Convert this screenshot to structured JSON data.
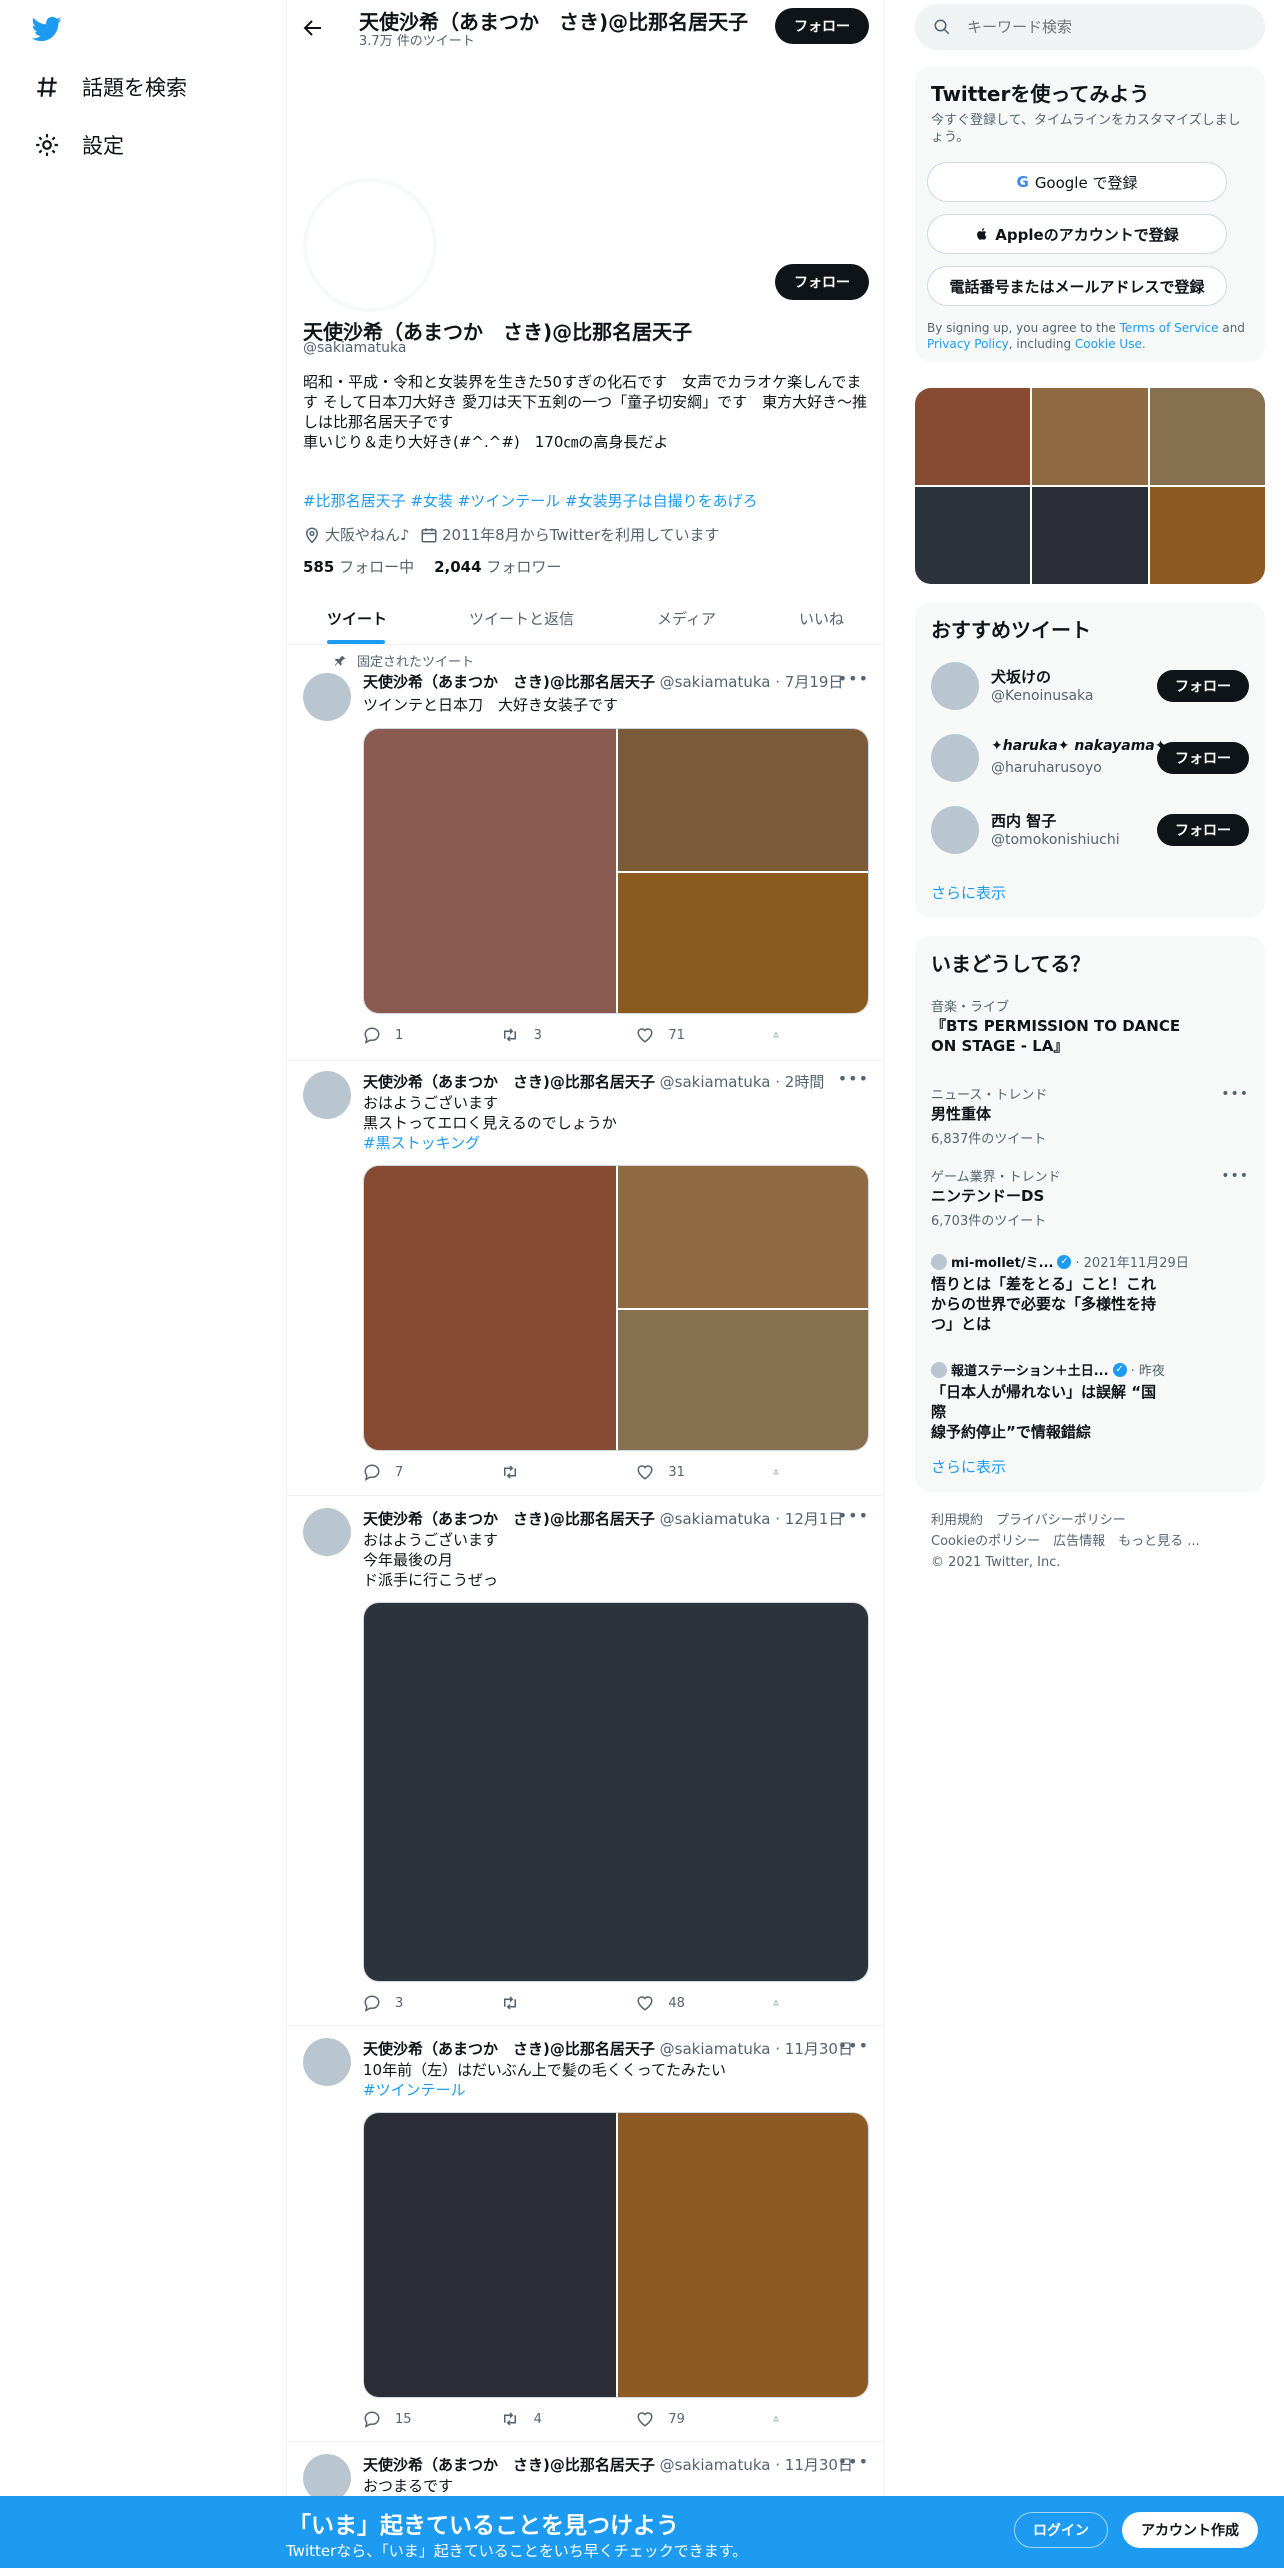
{
  "nav": {
    "explore_label": "話題を検索",
    "settings_label": "設定"
  },
  "header": {
    "name": "天使沙希（あまつか　さき)@比那名居天子",
    "tweet_count": "3.7万 件のツイート",
    "follow_label": "フォロー"
  },
  "profile": {
    "follow_label": "フォロー",
    "name": "天使沙希（あまつか　さき)@比那名居天子",
    "handle": "@sakiamatuka",
    "bio_line1": "昭和・平成・令和と女装界を生きた50すぎの化石です　女声でカラオケ楽しんでま",
    "bio_line2": "す そして日本刀大好き 愛刀は天下五剣の一つ「童子切安綱」です　東方大好き～推",
    "bio_line3": "しは比那名居天子です",
    "bio_line4": "車いじり＆走り大好き(#^.^#)　170㎝の高身長だよ",
    "hashtags": "#比那名居天子 #女装 #ツインテール #女装男子は自撮りをあげろ",
    "location": "大阪やねん♪",
    "joined": "2011年8月からTwitterを利用しています",
    "following_count": "585",
    "following_label": "フォロー中",
    "followers_count": "2,044",
    "followers_label": "フォロワー"
  },
  "tabs": [
    "ツイート",
    "ツイートと返信",
    "メディア",
    "いいね"
  ],
  "pinned_label": "固定されたツイート",
  "tweets": [
    {
      "name": "天使沙希（あまつか　さき)@比那名居天子",
      "meta": "@sakiamatuka · 7月19日",
      "text1": "ツインテと日本刀　大好き女装子です",
      "text2": "",
      "text3": "",
      "reply": "1",
      "retweet": "3",
      "like": "71"
    },
    {
      "name": "天使沙希（あまつか　さき)@比那名居天子",
      "meta": "@sakiamatuka · 2時間",
      "text1": "おはようございます",
      "text2": "黒ストってエロく見えるのでしょうか",
      "text3": "#黒ストッキング",
      "reply": "7",
      "retweet": "",
      "like": "31"
    },
    {
      "name": "天使沙希（あまつか　さき)@比那名居天子",
      "meta": "@sakiamatuka · 12月1日",
      "text1": "おはようございます",
      "text2": "今年最後の月",
      "text3": "ド派手に行こうぜっ",
      "reply": "3",
      "retweet": "",
      "like": "48"
    },
    {
      "name": "天使沙希（あまつか　さき)@比那名居天子",
      "meta": "@sakiamatuka · 11月30日",
      "text1": "10年前（左）はだいぶん上で髪の毛くくってたみたい",
      "text2": "#ツインテール",
      "text3": "",
      "reply": "15",
      "retweet": "4",
      "like": "79"
    },
    {
      "name": "天使沙希（あまつか　さき)@比那名居天子",
      "meta": "@sakiamatuka · 11月30日",
      "text1": "おつまるです",
      "text2": "",
      "text3": "",
      "reply": "",
      "retweet": "",
      "like": ""
    }
  ],
  "search": {
    "placeholder": "キーワード検索"
  },
  "signup": {
    "title": "Twitterを使ってみよう",
    "subtitle1": "今すぐ登録して、タイムラインをカスタマイズしまし",
    "subtitle2": "ょう。",
    "google": "Google で登録",
    "apple": "Appleのアカウントで登録",
    "phone": "電話番号またはメールアドレスで登録",
    "legal_pre": "By signing up, you agree to the ",
    "tos": "Terms of Service",
    "and": " and",
    "privacy": "Privacy Policy",
    "including": ", including ",
    "cookie": "Cookie Use."
  },
  "recommend": {
    "title": "おすすめツイート",
    "users": [
      {
        "name": "犬坂けの",
        "handle": "@Kenoinusaka",
        "follow": "フォロー"
      },
      {
        "name": "✦haruka✦ nakayama✦",
        "handle": "@haruharusoyo",
        "follow": "フォロー"
      },
      {
        "name": "西内 智子",
        "handle": "@tomokonishiuchi",
        "follow": "フォロー"
      }
    ],
    "more": "さらに表示"
  },
  "trends": {
    "title": "いまどうしてる？",
    "items": [
      {
        "category": "音楽・ライブ",
        "name1": "『BTS PERMISSION TO DANCE",
        "name2": "ON STAGE - LA』",
        "count": ""
      },
      {
        "category": "ニュース・トレンド",
        "name1": "男性重体",
        "name2": "",
        "count": "6,837件のツイート"
      },
      {
        "category": "ゲーム業界・トレンド",
        "name1": "ニンテンドーDS",
        "name2": "",
        "count": "6,703件のツイート"
      }
    ],
    "news": [
      {
        "source": "mi-mollet/ミ...",
        "time": "· 2021年11月29日",
        "line1": "悟りとは「差をとる」こと！これ",
        "line2": "からの世界で必要な「多様性を持",
        "line3": "つ」とは"
      },
      {
        "source": "報道ステーション＋土日...",
        "time": "· 昨夜",
        "line1": "「日本人が帰れない」は誤解 “国際",
        "line2": "線予約停止”で情報錯綜",
        "line3": ""
      }
    ],
    "more": "さらに表示"
  },
  "footer": {
    "line1": "利用規約　プライバシーポリシー",
    "line2": "Cookieのポリシー　広告情報　もっと見る ...",
    "line3": "© 2021 Twitter, Inc."
  },
  "bottom_bar": {
    "title": "「いま」起きていることを見つけよう",
    "subtitle": "Twitterなら、「いま」起きていることをいち早くチェックできます。",
    "login": "ログイン",
    "signup": "アカウント作成"
  },
  "colors": {
    "accent": "#1d9bf0",
    "bottom_bar": "#1d9bf0",
    "media": [
      "#8a5a50",
      "#7a5a37",
      "#8b5a1e",
      "#874a33",
      "#906a42",
      "#86704f",
      "#2d333c",
      "#2b2d36",
      "#8e5a24"
    ]
  }
}
